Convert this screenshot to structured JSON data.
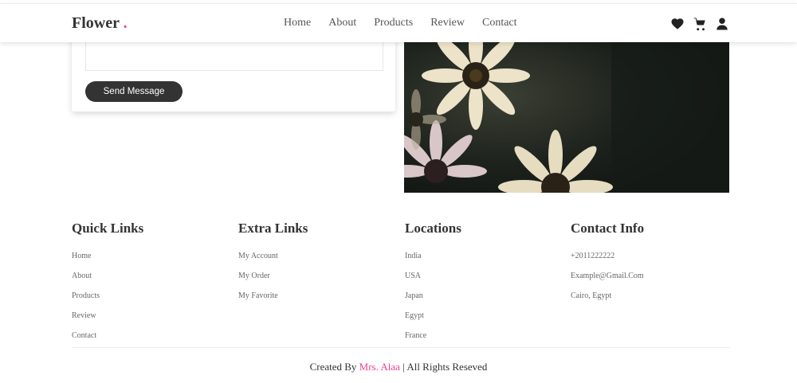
{
  "header": {
    "logo_text": "Flower",
    "logo_dot": ".",
    "nav": [
      "Home",
      "About",
      "Products",
      "Review",
      "Contact"
    ],
    "icons": [
      "heart-icon",
      "cart-icon",
      "user-icon"
    ]
  },
  "contact_form": {
    "send_label": "Send Message"
  },
  "footer": {
    "columns": [
      {
        "title": "Quick Links",
        "items": [
          "Home",
          "About",
          "Products",
          "Review",
          "Contact"
        ]
      },
      {
        "title": "Extra Links",
        "items": [
          "My Account",
          "My Order",
          "My Favorite"
        ]
      },
      {
        "title": "Locations",
        "items": [
          "India",
          "USA",
          "Japan",
          "Egypt",
          "France"
        ]
      },
      {
        "title": "Contact Info",
        "items": [
          "+2011222222",
          "Example@Gmail.Com",
          "Cairo, Egypt"
        ]
      }
    ],
    "credit_prefix": "Created By",
    "credit_author": "Mrs. Alaa",
    "credit_suffix": "| All Rights Reseved"
  },
  "colors": {
    "accent": "#e84393",
    "dark": "#333333"
  }
}
